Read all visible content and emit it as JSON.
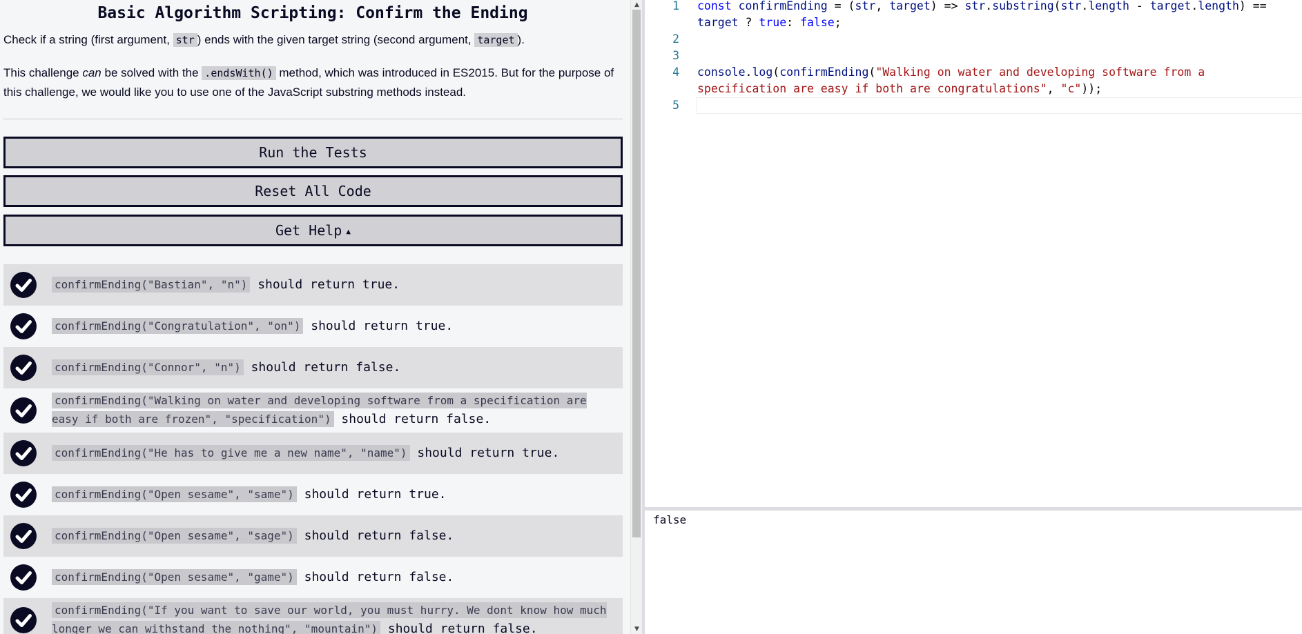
{
  "challenge": {
    "title": "Basic Algorithm Scripting: Confirm the Ending",
    "desc1_pre": "Check if a string (first argument, ",
    "desc1_code1": "str",
    "desc1_mid": ") ends with the given target string (second argument, ",
    "desc1_code2": "target",
    "desc1_post": ").",
    "desc2_pre": "This challenge ",
    "desc2_em": "can",
    "desc2_mid": " be solved with the ",
    "desc2_code": ".endsWith()",
    "desc2_post": " method, which was introduced in ES2015. But for the purpose of this challenge, we would like you to use one of the JavaScript substring methods instead."
  },
  "buttons": {
    "run": "Run the Tests",
    "reset": "Reset All Code",
    "help": "Get Help",
    "help_caret": "▲"
  },
  "tests": [
    {
      "code": "confirmEnding(\"Bastian\", \"n\")",
      "text": " should return true."
    },
    {
      "code": "confirmEnding(\"Congratulation\", \"on\")",
      "text": " should return true."
    },
    {
      "code": "confirmEnding(\"Connor\", \"n\")",
      "text": " should return false."
    },
    {
      "code": "confirmEnding(\"Walking on water and developing software from a specification are easy if both are frozen\", \"specification\")",
      "text": " should return false."
    },
    {
      "code": "confirmEnding(\"He has to give me a new name\", \"name\")",
      "text": " should return true."
    },
    {
      "code": "confirmEnding(\"Open sesame\", \"same\")",
      "text": " should return true."
    },
    {
      "code": "confirmEnding(\"Open sesame\", \"sage\")",
      "text": " should return false."
    },
    {
      "code": "confirmEnding(\"Open sesame\", \"game\")",
      "text": " should return false."
    },
    {
      "code": "confirmEnding(\"If you want to save our world, you must hurry. We dont know how much longer we can withstand the nothing\", \"mountain\")",
      "text": " should return false."
    }
  ],
  "editor": {
    "line_numbers": [
      "1",
      "2",
      "3",
      "4",
      "5"
    ],
    "l1_kw": "const",
    "l1_id": " confirmEnding",
    "l1_a": " = (",
    "l1_p1": "str",
    "l1_b": ", ",
    "l1_p2": "target",
    "l1_c": ") => ",
    "l1_p3": "str",
    "l1_d": ".",
    "l1_m": "substring",
    "l1_e": "(",
    "l1_p4": "str",
    "l1_f": ".",
    "l1_p5": "length",
    "l1_g": " - ",
    "l1_p6": "target",
    "l1_h": ".",
    "l1_p7": "length",
    "l1_i": ") == ",
    "l1_p8": "target",
    "l1_j": " ? ",
    "l1_t": "true",
    "l1_k": ": ",
    "l1_fl": "false",
    "l1_l": ";",
    "l4_obj": "console",
    "l4_a": ".",
    "l4_m": "log",
    "l4_b": "(",
    "l4_fn": "confirmEnding",
    "l4_c": "(",
    "l4_s1": "\"Walking on water and developing software from a specification are easy if both are congratulations\"",
    "l4_d": ", ",
    "l4_s2": "\"c\"",
    "l4_e": "));"
  },
  "console": {
    "output": "false"
  }
}
